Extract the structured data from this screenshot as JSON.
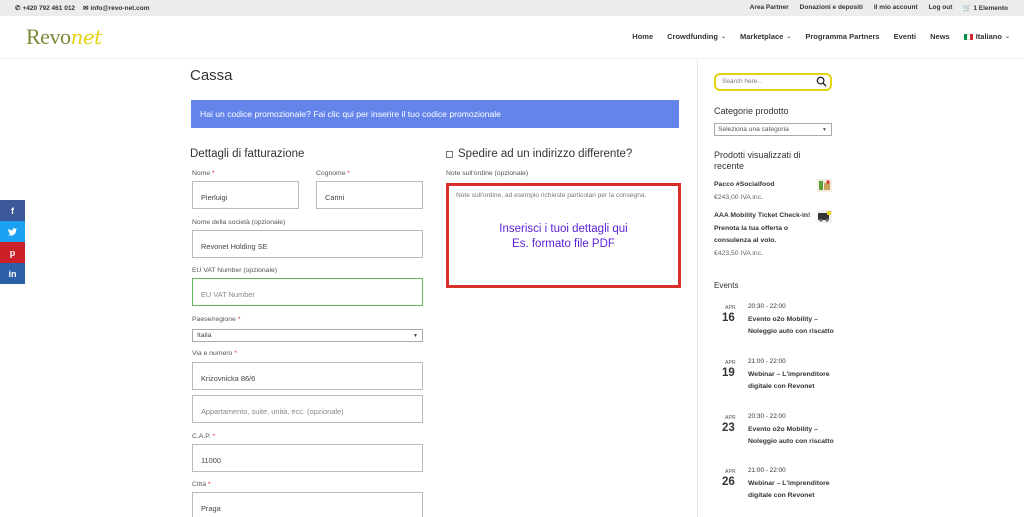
{
  "topbar": {
    "phone": "+420 792 461 012",
    "email": "info@revo-net.com",
    "links": [
      "Area Partner",
      "Donazioni e depositi",
      "Il mio account",
      "Log out"
    ],
    "cart": "1 Elemento"
  },
  "logo": {
    "part1": "Revo",
    "part2": "net"
  },
  "nav": {
    "home": "Home",
    "crowdfunding": "Crowdfunding",
    "marketplace": "Marketplace",
    "programma": "Programma Partners",
    "eventi": "Eventi",
    "news": "News",
    "lang": "Italiano"
  },
  "social": [
    "f",
    "t",
    "p",
    "in"
  ],
  "main": {
    "title": "Cassa",
    "promo": "Hai un codice promozionale? Fai clic qui per inserire il tuo codice promozionale",
    "billing_title": "Dettagli di fatturazione"
  },
  "form": {
    "nome_label": "Nome",
    "nome_value": "Pierluigi",
    "cognome_label": "Cognome",
    "cognome_value": "Carini",
    "societa_label": "Nome della società (opzionale)",
    "societa_value": "Revonet Holding SE",
    "vat_label": "EU VAT Number (opzionale)",
    "vat_placeholder": "EU VAT Number",
    "paese_label": "Paese/regione",
    "paese_value": "Italia",
    "via_label": "Via e numero",
    "via_value": "Krizovnicka 86/6",
    "appartamento_placeholder": "Appartamento, suite, unità, ecc. (opzionale)",
    "cap_label": "C.A.P.",
    "cap_value": "11000",
    "citta_label": "Città",
    "citta_value": "Praga",
    "required_mark": "*"
  },
  "shipping": {
    "checkbox_label": "Spedire ad un indirizzo differente?",
    "notes_label": "Note sull'ordine (opzionale)",
    "notes_placeholder": "Note sull'ordine, ad esempio richieste particolari per la consegna.",
    "overlay_line1": "Inserisci i tuoi dettagli qui",
    "overlay_line2": "Es. formato file PDF"
  },
  "sidebar": {
    "search_placeholder": "Search here..",
    "categorie_title": "Categorie prodotto",
    "categorie_select": "Seleziona una categoria",
    "visualizzati_title": "Prodotti visualizzati di recente",
    "products": [
      {
        "name": "Pacco #Socialfood",
        "price": "€243,00 IVA inc."
      },
      {
        "name": "AAA Mobility Ticket Check-in! Prenota la tua offerta o consulenza al volo.",
        "price": "€423,50 IVA inc."
      }
    ],
    "events_title": "Events",
    "events": [
      {
        "month": "APR",
        "day": "16",
        "time": "20:30 - 22:00",
        "title": "Evento o2o Mobility – Noleggio auto con riscatto"
      },
      {
        "month": "APR",
        "day": "19",
        "time": "21:00 - 22:00",
        "title": "Webinar – L'imprenditore digitale con Revonet"
      },
      {
        "month": "APR",
        "day": "23",
        "time": "20:30 - 22:00",
        "title": "Evento o2o Mobility – Noleggio auto con riscatto"
      },
      {
        "month": "APR",
        "day": "26",
        "time": "21:00 - 22:00",
        "title": "Webinar – L'imprenditore digitale con Revonet"
      }
    ]
  },
  "colors": {
    "promo_bg": "#6484ea",
    "brand_green": "#7c8a3a",
    "brand_yellow": "#e3d312",
    "notes_border": "#d9302b",
    "overlay_text": "#5a1fd8",
    "facebook": "#3b5998",
    "twitter": "#1da1f2",
    "pinterest": "#cb2027",
    "linkedin": "#2d5fa8"
  }
}
